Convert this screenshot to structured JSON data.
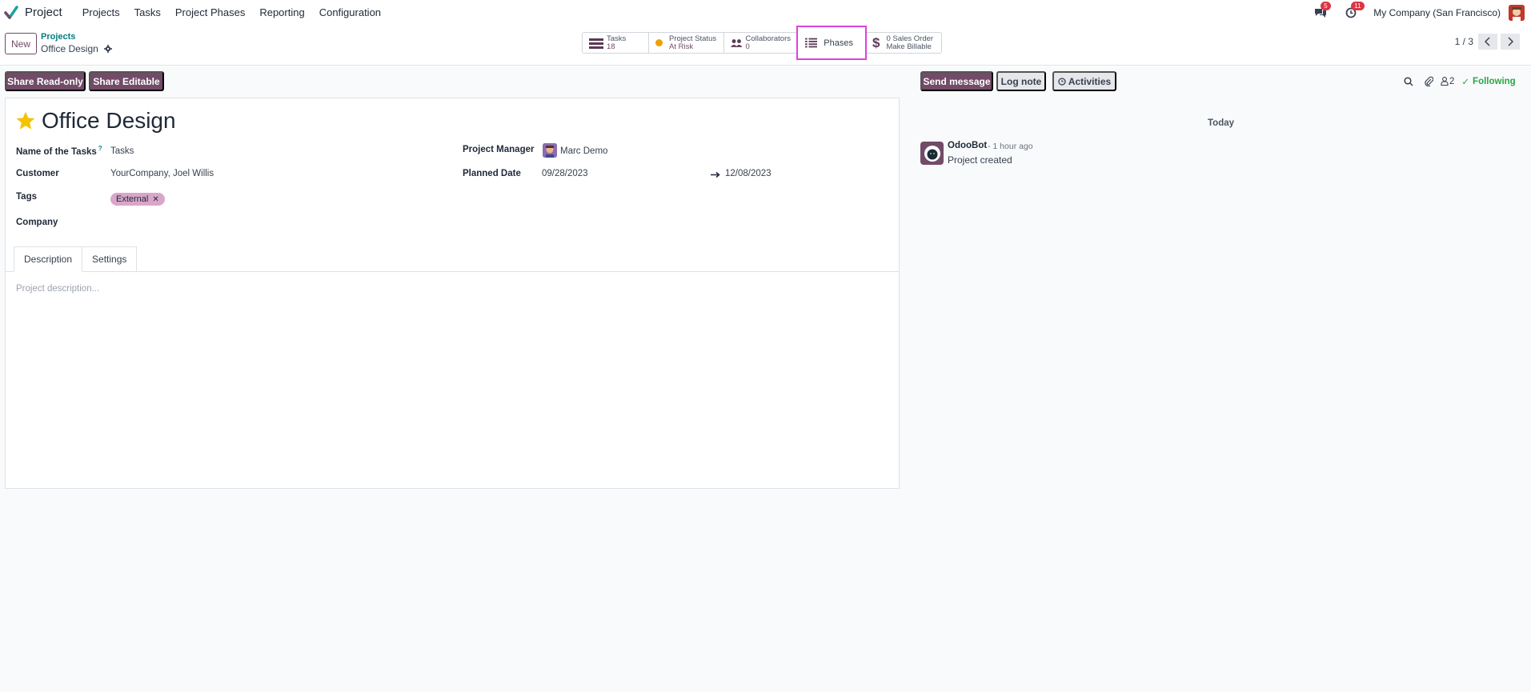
{
  "navbar": {
    "app_name": "Project",
    "menu": [
      "Projects",
      "Tasks",
      "Project Phases",
      "Reporting",
      "Configuration"
    ],
    "messages_badge": "5",
    "activities_badge": "11",
    "company": "My Company (San Francisco)"
  },
  "control": {
    "new_label": "New",
    "breadcrumb_parent": "Projects",
    "breadcrumb_current": "Office Design",
    "smart_buttons": {
      "tasks": {
        "title": "Tasks",
        "value": "18"
      },
      "status": {
        "title": "Project Status",
        "value": "At Risk"
      },
      "collaborators": {
        "title": "Collaborators",
        "value": "0"
      },
      "phases": {
        "label": "Phases"
      },
      "sales": {
        "title": "0 Sales Order",
        "value": "Make Billable"
      }
    },
    "pager": "1 / 3"
  },
  "actions": {
    "share_readonly": "Share Read-only",
    "share_editable": "Share Editable"
  },
  "form": {
    "title": "Office Design",
    "fields": {
      "name_tasks_label": "Name of the Tasks",
      "name_tasks_help": "?",
      "name_tasks_value": "Tasks",
      "customer_label": "Customer",
      "customer_value": "YourCompany, Joel Willis",
      "tags_label": "Tags",
      "tag": "External",
      "company_label": "Company",
      "manager_label": "Project Manager",
      "manager_value": "Marc Demo",
      "planned_label": "Planned Date",
      "planned_start": "09/28/2023",
      "planned_end": "12/08/2023"
    },
    "tabs": [
      "Description",
      "Settings"
    ],
    "description_placeholder": "Project description..."
  },
  "chatter": {
    "send_message": "Send message",
    "log_note": "Log note",
    "activities": "Activities",
    "followers_count": "2",
    "following": "Following",
    "date_separator": "Today",
    "message": {
      "author": "OdooBot",
      "time": "- 1 hour ago",
      "body": "Project created"
    }
  },
  "colors": {
    "brand": "#714b67",
    "link": "#017e84",
    "highlight": "#e040e0",
    "status_at_risk": "#f0a000",
    "following": "#28a745"
  }
}
